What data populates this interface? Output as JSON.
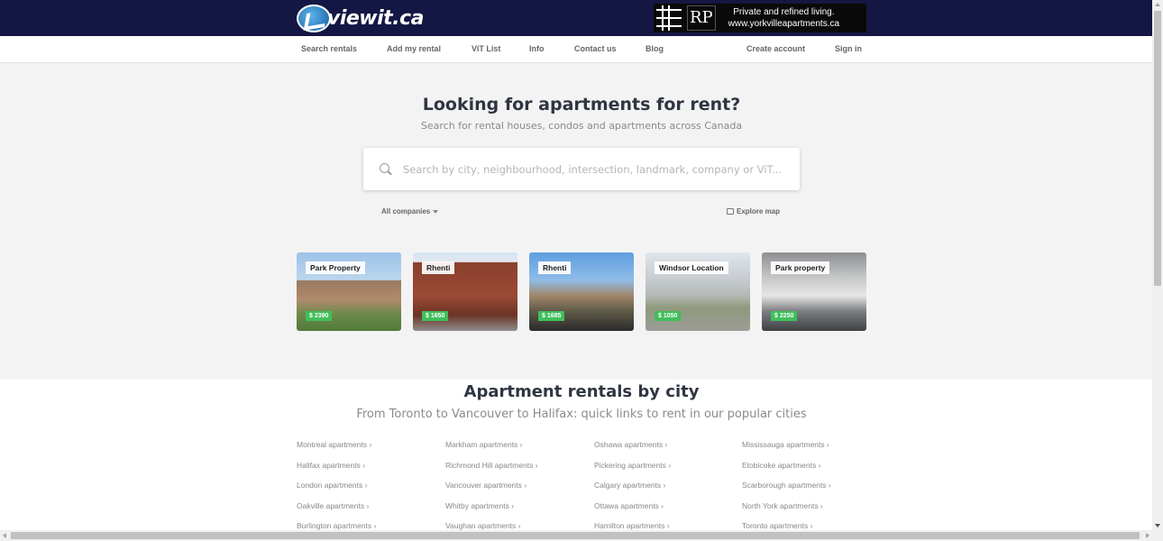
{
  "header": {
    "logo_text": "viewit.ca",
    "ad": {
      "logo_text": "RP",
      "line1": "Private and refined living.",
      "line2": "www.yorkvilleapartments.ca"
    }
  },
  "nav": {
    "items": [
      "Search rentals",
      "Add my rental",
      "ViT List",
      "Info",
      "Contact us",
      "Blog"
    ],
    "account": [
      "Create account",
      "Sign in"
    ]
  },
  "hero": {
    "title": "Looking for apartments for rent?",
    "subtitle": "Search for rental houses, condos and apartments across Canada",
    "search_placeholder": "Search by city, neighbourhood, intersection, landmark, company or ViT...",
    "filter_label": "All companies",
    "explore_label": "Explore map"
  },
  "listings": [
    {
      "company": "Park Property",
      "price": "$ 2390"
    },
    {
      "company": "Rhenti",
      "price": "$ 1650"
    },
    {
      "company": "Rhenti",
      "price": "$ 1685"
    },
    {
      "company": "Windsor Location",
      "price": "$ 1050"
    },
    {
      "company": "Park property",
      "price": "$ 2250"
    }
  ],
  "cities": {
    "title": "Apartment rentals by city",
    "subtitle": "From Toronto to Vancouver to Halifax: quick links to rent in our popular cities",
    "columns": [
      [
        "Montreal apartments ›",
        "Halifax apartments ›",
        "London apartments ›",
        "Oakville apartments ›",
        "Burlington apartments ›"
      ],
      [
        "Markham apartments ›",
        "Richmond Hill apartments ›",
        "Vancouver apartments ›",
        "Whitby apartments ›",
        "Vaughan apartments ›"
      ],
      [
        "Oshawa apartments ›",
        "Pickering apartments ›",
        "Calgary apartments ›",
        "Ottawa apartments ›",
        "Hamilton apartments ›"
      ],
      [
        "Mississauga apartments ›",
        "Etobicoke apartments ›",
        "Scarborough apartments ›",
        "North York apartments ›",
        "Toronto apartments ›"
      ]
    ]
  },
  "colors": {
    "topbar": "#141743",
    "price_badge": "#3fbf5a",
    "page_bg": "#f3f3f3"
  }
}
